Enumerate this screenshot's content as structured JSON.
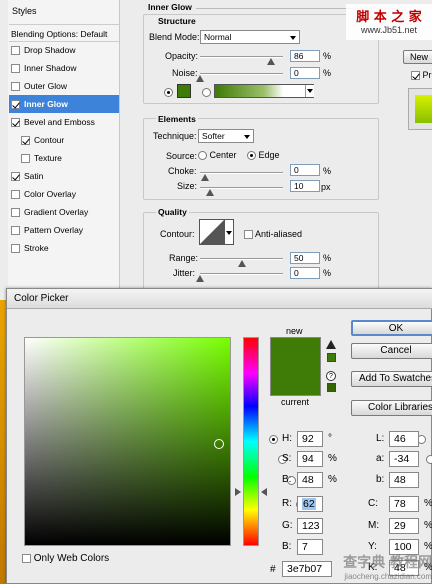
{
  "sidebar": {
    "header": "Styles",
    "items": [
      {
        "label": "Blending Options: Default",
        "check": null,
        "selected": false
      },
      {
        "label": "Drop Shadow",
        "check": false,
        "selected": false
      },
      {
        "label": "Inner Shadow",
        "check": false,
        "selected": false
      },
      {
        "label": "Outer Glow",
        "check": false,
        "selected": false
      },
      {
        "label": "Inner Glow",
        "check": true,
        "selected": true
      },
      {
        "label": "Bevel and Emboss",
        "check": true,
        "selected": false
      },
      {
        "label": "Contour",
        "check": true,
        "selected": false
      },
      {
        "label": "Texture",
        "check": false,
        "selected": false
      },
      {
        "label": "Satin",
        "check": true,
        "selected": false
      },
      {
        "label": "Color Overlay",
        "check": false,
        "selected": false
      },
      {
        "label": "Gradient Overlay",
        "check": false,
        "selected": false
      },
      {
        "label": "Pattern Overlay",
        "check": false,
        "selected": false
      },
      {
        "label": "Stroke",
        "check": false,
        "selected": false
      }
    ]
  },
  "inner_glow": {
    "title": "Inner Glow",
    "structure": {
      "title": "Structure",
      "blend_mode_label": "Blend Mode:",
      "blend_mode_value": "Normal",
      "opacity_label": "Opacity:",
      "opacity_value": "86",
      "opacity_level": 0.86,
      "noise_label": "Noise:",
      "noise_value": "0",
      "noise_level": 0,
      "unit": "%",
      "glow_color": "#3e7b07"
    },
    "elements": {
      "title": "Elements",
      "technique_label": "Technique:",
      "technique_value": "Softer",
      "source_label": "Source:",
      "source_center": "Center",
      "source_edge": "Edge",
      "choke_label": "Choke:",
      "choke_value": "0",
      "choke_unit": "%",
      "size_label": "Size:",
      "size_value": "10",
      "size_unit": "px"
    },
    "quality": {
      "title": "Quality",
      "contour_label": "Contour:",
      "anti_aliased_label": "Anti-aliased",
      "range_label": "Range:",
      "range_value": "50",
      "range_level": 0.5,
      "jitter_label": "Jitter:",
      "jitter_value": "0",
      "jitter_level": 0,
      "unit": "%"
    }
  },
  "right_partial": {
    "new_label": "New",
    "preview_label": "Pr"
  },
  "watermark_top": {
    "line1": "脚 本 之 家",
    "line2": "www.Jb51.net"
  },
  "color_picker": {
    "title": "Color Picker",
    "new_label": "new",
    "current_label": "current",
    "new_color": "#3e7b07",
    "current_color": "#3e7b07",
    "ok_label": "OK",
    "cancel_label": "Cancel",
    "add_swatches_label": "Add To Swatches",
    "color_libraries_label": "Color Libraries",
    "only_web_colors_label": "Only Web Colors",
    "fields": {
      "H": {
        "label": "H:",
        "value": "92",
        "unit": "°"
      },
      "S": {
        "label": "S:",
        "value": "94",
        "unit": "%"
      },
      "B": {
        "label": "B:",
        "value": "48",
        "unit": "%"
      },
      "R": {
        "label": "R:",
        "value": "62",
        "unit": ""
      },
      "G": {
        "label": "G:",
        "value": "123",
        "unit": ""
      },
      "Bb": {
        "label": "B:",
        "value": "7",
        "unit": ""
      },
      "L": {
        "label": "L:",
        "value": "46",
        "unit": ""
      },
      "a": {
        "label": "a:",
        "value": "-34",
        "unit": ""
      },
      "b": {
        "label": "b:",
        "value": "48",
        "unit": ""
      },
      "C": {
        "label": "C:",
        "value": "78",
        "unit": "%"
      },
      "M": {
        "label": "M:",
        "value": "29",
        "unit": "%"
      },
      "Y": {
        "label": "Y:",
        "value": "100",
        "unit": "%"
      },
      "K": {
        "label": "K:",
        "value": "48",
        "unit": "%"
      }
    },
    "hex_label": "#",
    "hex_value": "3e7b07",
    "hue_color": "#77ff00"
  },
  "watermark_bottom": {
    "line1": "查字典 教程网",
    "line2": "jiaocheng.chazidian.com"
  }
}
